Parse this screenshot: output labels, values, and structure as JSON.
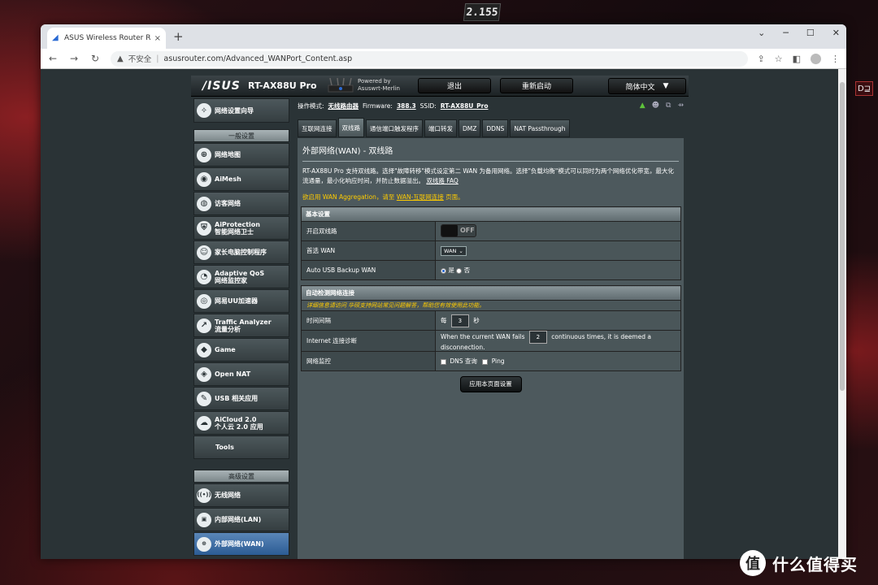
{
  "wallpaper": {
    "tag": "2.155",
    "corner_badge": "D⊒"
  },
  "watermark": {
    "logo": "值",
    "text": "什么值得买"
  },
  "browser": {
    "tab_title": "ASUS Wireless Router RT-AX88U Pro",
    "tab_close": "×",
    "new_tab": "+",
    "win_controls": {
      "minimize": "⌄",
      "min2": "─",
      "max": "☐",
      "close": "✕"
    },
    "nav": {
      "back": "←",
      "forward": "→",
      "reload": "↻"
    },
    "address": {
      "warning": "▲",
      "insecure": "不安全",
      "sep": "|",
      "url": "asusrouter.com/Advanced_WANPort_Content.asp"
    },
    "toolbar_icons": {
      "share": "⇪",
      "star": "☆",
      "sidebar": "◧",
      "menu": "⋮"
    }
  },
  "router": {
    "logo": "/ISUS",
    "model": "RT-AX88U Pro",
    "powered_line1": "Powered by",
    "powered_line2": "Asuswrt-Merlin",
    "logout": "退出",
    "reboot": "重新启动",
    "language": "简体中文",
    "language_arrow": "▼",
    "status": {
      "mode_label": "操作模式:",
      "mode_value": "无线路由器",
      "fw_label": "Firmware:",
      "fw_value": "388.3",
      "ssid_label": "SSID:",
      "ssid_value": "RT-AX88U_Pro"
    },
    "sidebar": {
      "wizard": "网络设置向导",
      "general_head": "一般设置",
      "general": [
        {
          "l1": "网络地图",
          "l2": "",
          "icon": "⊕"
        },
        {
          "l1": "AiMesh",
          "l2": "",
          "icon": "◉"
        },
        {
          "l1": "访客网络",
          "l2": "",
          "icon": "◍"
        },
        {
          "l1": "AiProtection",
          "l2": "智能网络卫士",
          "icon": "⛨"
        },
        {
          "l1": "家长电脑控制程序",
          "l2": "",
          "icon": "☺"
        },
        {
          "l1": "Adaptive QoS",
          "l2": "网络监控家",
          "icon": "◔"
        },
        {
          "l1": "网易UU加速器",
          "l2": "",
          "icon": "◎"
        },
        {
          "l1": "Traffic Analyzer",
          "l2": "流量分析",
          "icon": "↗"
        },
        {
          "l1": "Game",
          "l2": "",
          "icon": "◆"
        },
        {
          "l1": "Open NAT",
          "l2": "",
          "icon": "◈"
        },
        {
          "l1": "USB 相关应用",
          "l2": "",
          "icon": "✎"
        },
        {
          "l1": "AiCloud 2.0",
          "l2": "个人云 2.0 应用",
          "icon": "☁"
        }
      ],
      "tools": "Tools",
      "advanced_head": "高级设置",
      "advanced": [
        {
          "l1": "无线网络",
          "icon": "((•))"
        },
        {
          "l1": "内部网络(LAN)",
          "icon": "▣"
        },
        {
          "l1": "外部网络(WAN)",
          "icon": "⊕"
        }
      ]
    },
    "tabs": [
      "互联网连接",
      "双线路",
      "通信端口触发程序",
      "端口转发",
      "DMZ",
      "DDNS",
      "NAT Passthrough"
    ],
    "page_title": "外部网络(WAN) - 双线路",
    "desc": "RT-AX88U Pro 支持双线路。选择\"故障转移\"模式设定第二 WAN 为备用网络。选择\"负载均衡\"模式可以同时为两个网络优化带宽，最大化流通量，最小化响应时间，并防止数据溢出。",
    "desc_link": "双线路 FAQ",
    "hint_pre": "欲启用 WAN Aggregation，请至",
    "hint_link": "WAN-互联网连接",
    "hint_post": "页面。",
    "basic": {
      "head": "基本设置",
      "enable_label": "开启双线路",
      "enable_state": "OFF",
      "primary_label": "首选 WAN",
      "primary_value": "WAN",
      "primary_arrow": "⌄",
      "usb_label": "Auto USB Backup WAN",
      "usb_yes": "是",
      "usb_no": "否"
    },
    "detect": {
      "head": "自动检测网络连接",
      "sub": "详细信息请访问 华硕支持网站常见问题解答，帮助您有效使用此功能。",
      "interval_label": "时间间隔",
      "interval_pre": "每",
      "interval_value": "3",
      "interval_unit": "秒",
      "diag_label": "Internet 连接诊断",
      "diag_pre": "When the current WAN fails",
      "diag_value": "2",
      "diag_post": "continuous times, it is deemed a disconnection.",
      "monitor_label": "网络监控",
      "monitor_dns": "DNS 查询",
      "monitor_ping": "Ping"
    },
    "apply": "应用本页面设置"
  }
}
